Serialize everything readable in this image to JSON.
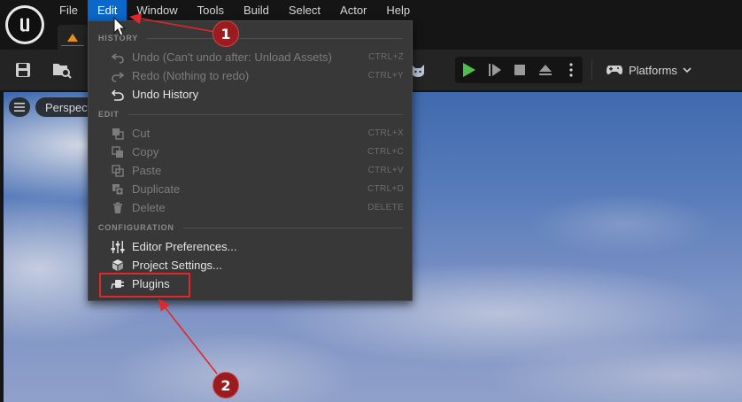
{
  "menubar": {
    "items": [
      "File",
      "Edit",
      "Window",
      "Tools",
      "Build",
      "Select",
      "Actor",
      "Help"
    ],
    "active": "Edit"
  },
  "toolbar": {
    "platforms_label": "Platforms"
  },
  "viewport": {
    "perspective_label": "Perspective"
  },
  "edit_menu": {
    "sections": {
      "history": "HISTORY",
      "edit": "EDIT",
      "configuration": "CONFIGURATION"
    },
    "items": {
      "undo": {
        "label": "Undo (Can't undo after: Unload Assets)",
        "shortcut": "CTRL+Z"
      },
      "redo": {
        "label": "Redo (Nothing to redo)",
        "shortcut": "CTRL+Y"
      },
      "undo_history": {
        "label": "Undo History"
      },
      "cut": {
        "label": "Cut",
        "shortcut": "CTRL+X"
      },
      "copy": {
        "label": "Copy",
        "shortcut": "CTRL+C"
      },
      "paste": {
        "label": "Paste",
        "shortcut": "CTRL+V"
      },
      "duplicate": {
        "label": "Duplicate",
        "shortcut": "CTRL+D"
      },
      "delete": {
        "label": "Delete",
        "shortcut": "DELETE"
      },
      "editor_preferences": {
        "label": "Editor Preferences..."
      },
      "project_settings": {
        "label": "Project Settings..."
      },
      "plugins": {
        "label": "Plugins"
      }
    }
  },
  "annotations": {
    "step_1": "1",
    "step_2": "2",
    "color": "#e3262b"
  }
}
